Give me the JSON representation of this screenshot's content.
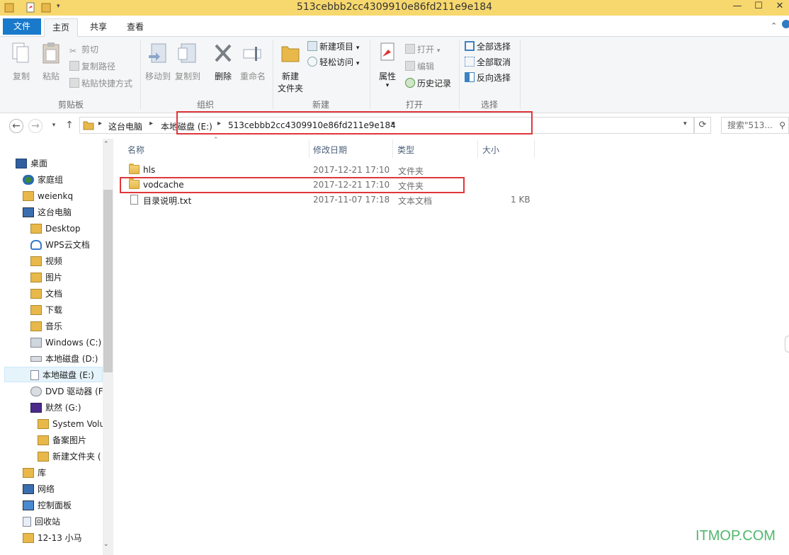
{
  "window": {
    "title": "513cebbb2cc4309910e86fd211e9e184",
    "minimize": "—",
    "maximize": "☐",
    "close": "✕"
  },
  "tabs": {
    "file": "文件",
    "home": "主页",
    "share": "共享",
    "view": "查看"
  },
  "ribbon": {
    "clipboard": {
      "label": "剪贴板",
      "copy": "复制",
      "paste": "粘贴",
      "cut": "剪切",
      "copy_path": "复制路径",
      "paste_shortcut": "粘贴快捷方式"
    },
    "organize": {
      "label": "组织",
      "move_to": "移动到",
      "copy_to": "复制到",
      "delete": "删除",
      "rename": "重命名"
    },
    "new": {
      "label": "新建",
      "new_folder_line1": "新建",
      "new_folder_line2": "文件夹",
      "new_item": "新建项目",
      "easy_access": "轻松访问"
    },
    "open": {
      "label": "打开",
      "properties": "属性",
      "open": "打开",
      "edit": "编辑",
      "history": "历史记录"
    },
    "select": {
      "label": "选择",
      "select_all": "全部选择",
      "select_none": "全部取消",
      "invert": "反向选择"
    }
  },
  "address": {
    "crumbs": [
      "这台电脑",
      "本地磁盘 (E:)",
      "513cebbb2cc4309910e86fd211e9e184"
    ],
    "search_placeholder": "搜索\"513..."
  },
  "nav_items": [
    {
      "label": "桌面",
      "icon": "desktop-icon"
    },
    {
      "label": "家庭组",
      "icon": "homegroup-icon"
    },
    {
      "label": "weienkq",
      "icon": "user-folder-icon"
    },
    {
      "label": "这台电脑",
      "icon": "computer-icon"
    },
    {
      "label": "Desktop",
      "icon": "folder-icon"
    },
    {
      "label": "WPS云文档",
      "icon": "cloud-icon"
    },
    {
      "label": "视频",
      "icon": "video-folder-icon"
    },
    {
      "label": "图片",
      "icon": "pictures-folder-icon"
    },
    {
      "label": "文档",
      "icon": "documents-folder-icon"
    },
    {
      "label": "下载",
      "icon": "downloads-folder-icon"
    },
    {
      "label": "音乐",
      "icon": "music-folder-icon"
    },
    {
      "label": "Windows (C:)",
      "icon": "windows-drive-icon"
    },
    {
      "label": "本地磁盘 (D:)",
      "icon": "drive-icon"
    },
    {
      "label": "本地磁盘 (E:)",
      "icon": "drive-icon"
    },
    {
      "label": "DVD 驱动器 (F",
      "icon": "dvd-drive-icon"
    },
    {
      "label": "默然 (G:)",
      "icon": "usb-drive-icon"
    },
    {
      "label": "System Volu",
      "icon": "folder-icon"
    },
    {
      "label": "备案图片",
      "icon": "folder-icon"
    },
    {
      "label": "新建文件夹 (",
      "icon": "folder-icon"
    },
    {
      "label": "库",
      "icon": "library-icon"
    },
    {
      "label": "网络",
      "icon": "network-icon"
    },
    {
      "label": "控制面板",
      "icon": "control-panel-icon"
    },
    {
      "label": "回收站",
      "icon": "recycle-bin-icon"
    },
    {
      "label": "12-13 小马",
      "icon": "folder-icon"
    }
  ],
  "columns": {
    "name": "名称",
    "date": "修改日期",
    "type": "类型",
    "size": "大小"
  },
  "files": [
    {
      "name": "hls",
      "date": "2017-12-21 17:10",
      "type": "文件夹",
      "size": "",
      "icon": "folder-icon"
    },
    {
      "name": "vodcache",
      "date": "2017-12-21 17:10",
      "type": "文件夹",
      "size": "",
      "icon": "folder-icon"
    },
    {
      "name": "目录说明.txt",
      "date": "2017-11-07 17:18",
      "type": "文本文档",
      "size": "1 KB",
      "icon": "text-file-icon"
    }
  ],
  "watermark": "ITMOP.COM",
  "colors": {
    "title_bar": "#f7d86e",
    "file_tab": "#1979ca",
    "highlight_box": "#e0373a",
    "watermark": "#4fb86c"
  }
}
